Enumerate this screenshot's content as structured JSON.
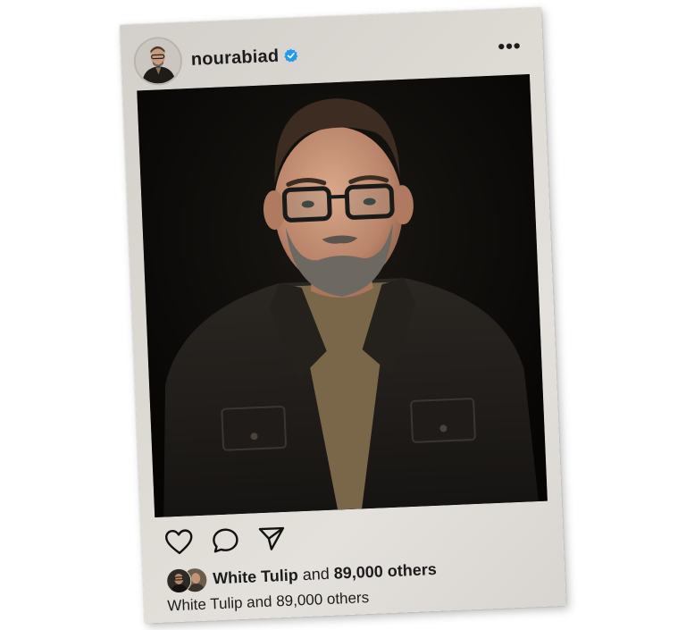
{
  "post": {
    "username": "nourabiad",
    "more_label": "•••",
    "liked_by_name": "White Tulip",
    "liked_by_joiner": " and ",
    "liked_by_count": "89,000 others",
    "caption": "White Tulip and 89,000 others"
  },
  "icons": {
    "verified": "verified-badge-icon",
    "like": "heart-icon",
    "comment": "comment-bubble-icon",
    "share": "paper-plane-icon",
    "more": "more-options-icon"
  },
  "colors": {
    "frame": "#dcd8d2",
    "text": "#1c1c1c",
    "verified": "#1d9bf0",
    "photo_bg": "#0b0a08"
  }
}
